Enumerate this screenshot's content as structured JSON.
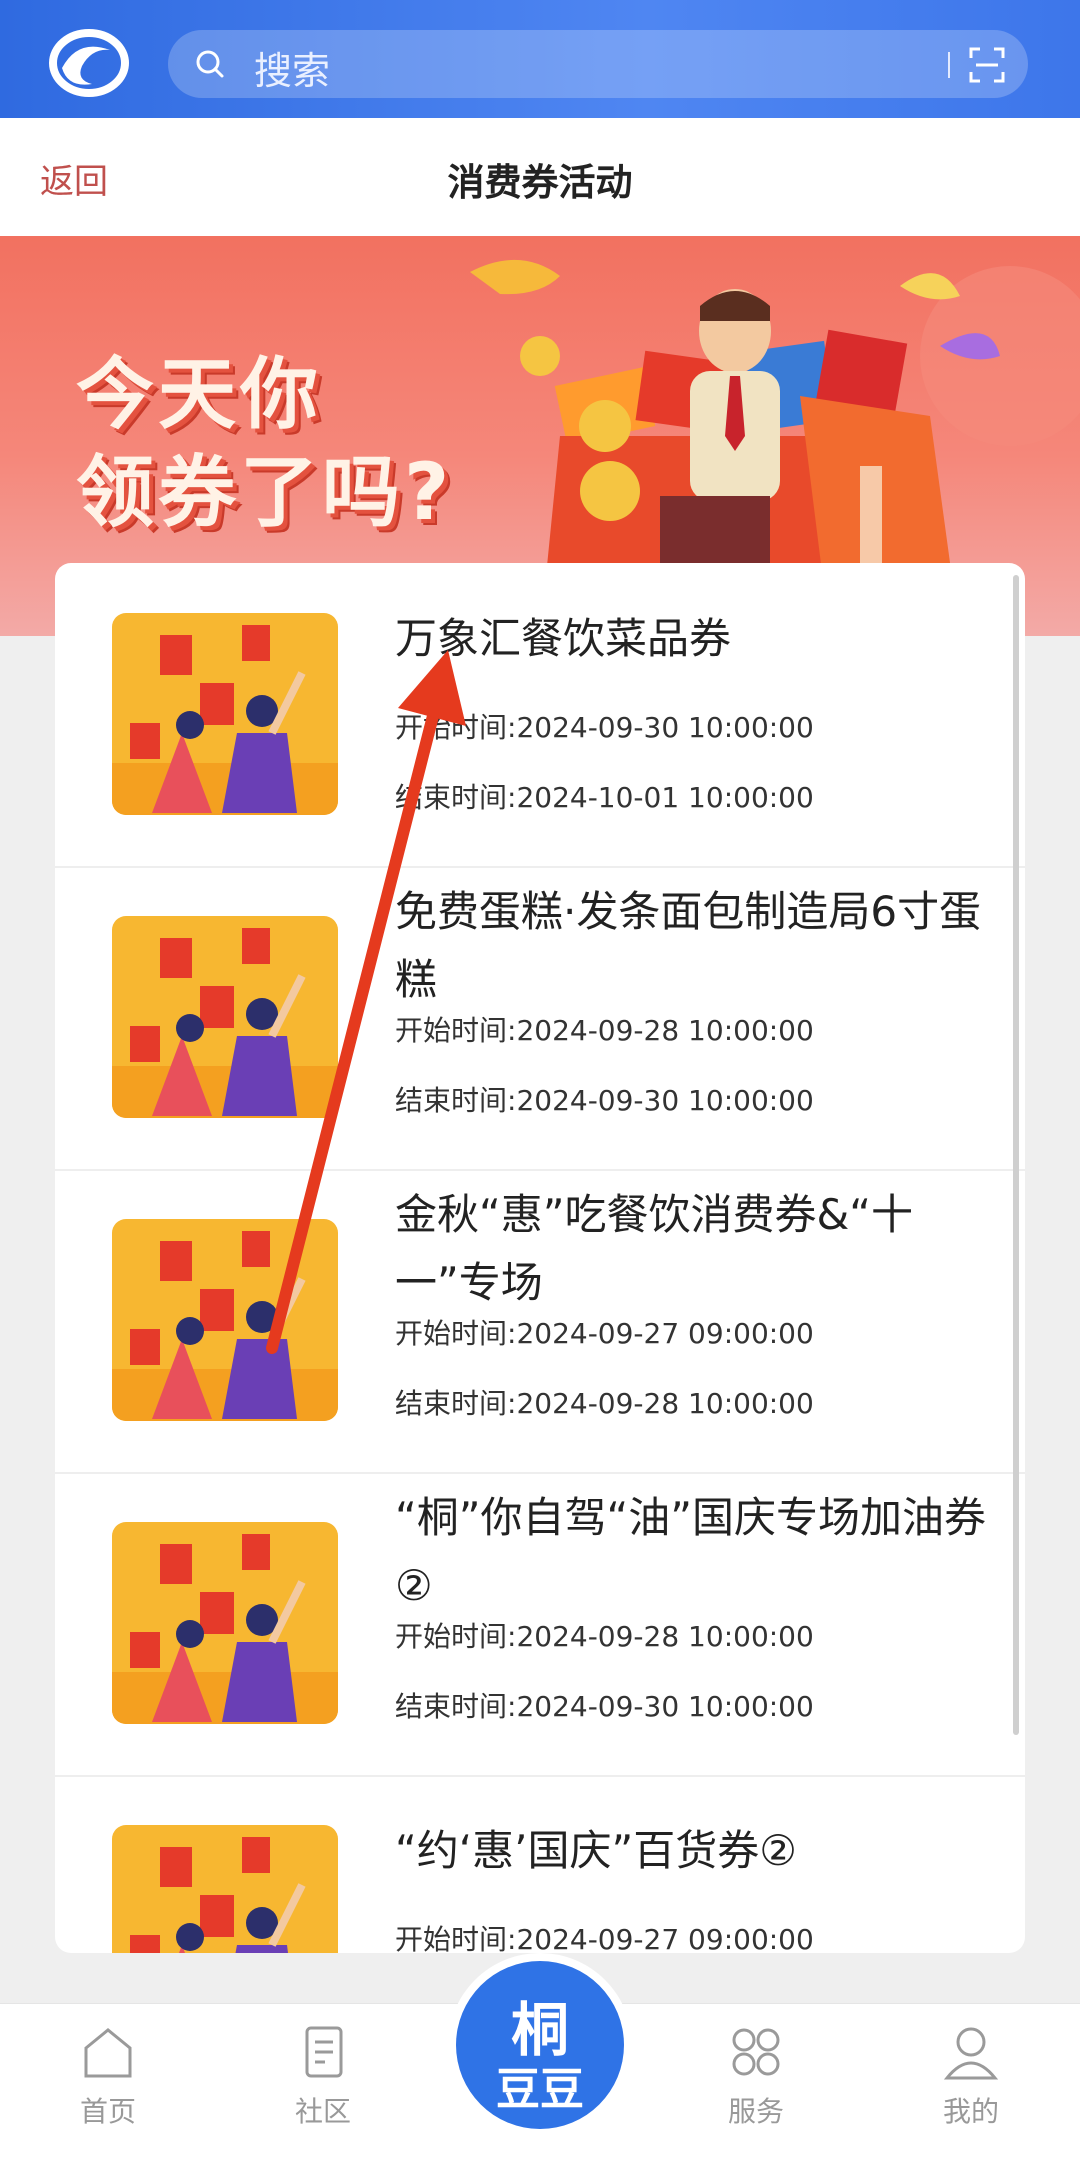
{
  "search": {
    "placeholder": "搜索"
  },
  "nav": {
    "back_label": "返回",
    "title": "消费券活动"
  },
  "banner": {
    "line1": "今天你",
    "line2": "领券了吗?"
  },
  "coupons": [
    {
      "title": "万象汇餐饮菜品券",
      "start_label": "开始时间:",
      "start": "2024-09-30 10:00:00",
      "end_label": "结束时间:",
      "end": "2024-10-01 10:00:00"
    },
    {
      "title": "免费蛋糕·发条面包制造局6寸蛋糕",
      "start_label": "开始时间:",
      "start": "2024-09-28 10:00:00",
      "end_label": "结束时间:",
      "end": "2024-09-30 10:00:00"
    },
    {
      "title": "金秋“惠”吃餐饮消费券&“十一”专场",
      "start_label": "开始时间:",
      "start": "2024-09-27 09:00:00",
      "end_label": "结束时间:",
      "end": "2024-09-28 10:00:00"
    },
    {
      "title": "“桐”你自驾“油”国庆专场加油券②",
      "start_label": "开始时间:",
      "start": "2024-09-28 10:00:00",
      "end_label": "结束时间:",
      "end": "2024-09-30 10:00:00"
    },
    {
      "title": "“约‘惠’国庆”百货券②",
      "start_label": "开始时间:",
      "start": "2024-09-27 09:00:00"
    }
  ],
  "tabbar": {
    "home": "首页",
    "community": "社区",
    "center_line1": "桐",
    "center_line2": "豆豆",
    "services": "服务",
    "mine": "我的"
  },
  "colors": {
    "brand": "#2f73e6",
    "back": "#c0504d",
    "arrow": "#e53a1e"
  }
}
